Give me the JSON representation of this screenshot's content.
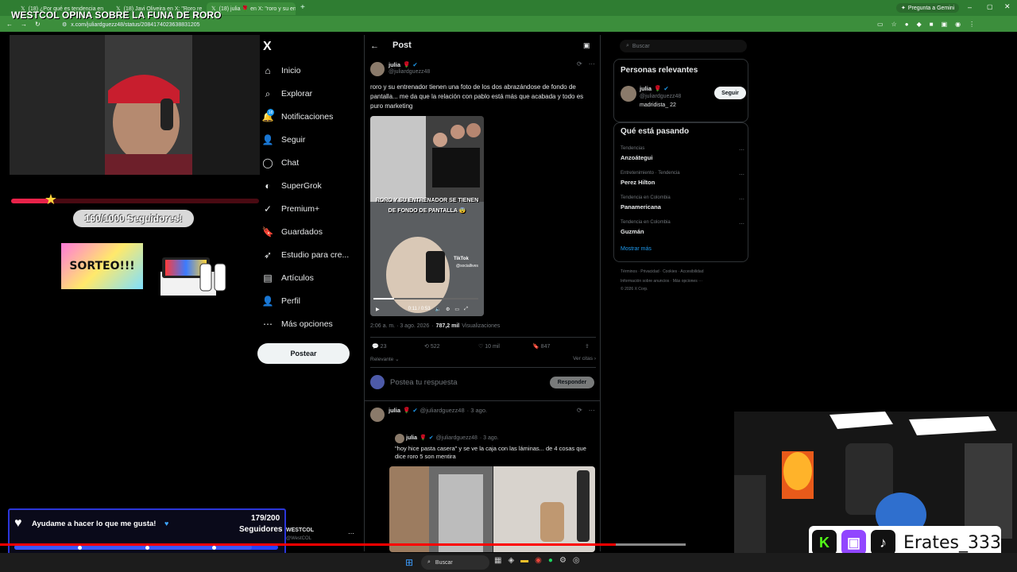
{
  "browser": {
    "tabs": [
      {
        "label": "(18) ¿Por qué es tendencia en"
      },
      {
        "label": "(18) Javi Oliveira en X: \"Roro re"
      },
      {
        "label": "(18) julia 🌹 en X: \"roro y su en"
      }
    ],
    "url": "x.com/juliardguezz48/status/2084174023638831205",
    "gemini_label": "Pregunta a Gemini"
  },
  "stream": {
    "title": "WESTCOL OPINA SOBRE LA FUNA DE RORO",
    "followers_goal": "160/1000 Seguidores!",
    "followers_progress": 0.16,
    "sorteo_label": "SORTEO!!!",
    "goal_text": "Ayudame a hacer lo que me gusta!",
    "goal_count": "179/200",
    "goal_unit": "Seguidores",
    "goal_progress": 0.9,
    "westcol_label": "WESTCOL",
    "westcol_handle": "@WestCOL",
    "social_handle": "Erates_333"
  },
  "x_nav": {
    "logo": "X",
    "items": [
      {
        "label": "Inicio",
        "icon": "home-icon",
        "glyph": "⌂"
      },
      {
        "label": "Explorar",
        "icon": "search-icon",
        "glyph": "⌕"
      },
      {
        "label": "Notificaciones",
        "icon": "bell-icon",
        "glyph": "🔔"
      },
      {
        "label": "Seguir",
        "icon": "follow-icon",
        "glyph": "👤"
      },
      {
        "label": "Chat",
        "icon": "chat-icon",
        "glyph": "◯"
      },
      {
        "label": "SuperGrok",
        "icon": "grok-icon",
        "glyph": "◐"
      },
      {
        "label": "Premium+",
        "icon": "premium-icon",
        "glyph": "✓"
      },
      {
        "label": "Guardados",
        "icon": "bookmark-icon",
        "glyph": "🔖"
      },
      {
        "label": "Estudio para cre...",
        "icon": "studio-icon",
        "glyph": "➶"
      },
      {
        "label": "Artículos",
        "icon": "articles-icon",
        "glyph": "▤"
      },
      {
        "label": "Perfil",
        "icon": "profile-icon",
        "glyph": "👤"
      },
      {
        "label": "Más opciones",
        "icon": "more-icon",
        "glyph": "⋯"
      }
    ],
    "notifications_badge": "18",
    "post_button": "Postear"
  },
  "post": {
    "header": "Post",
    "author": "julia",
    "handle": "@juliardguezz48",
    "text": "roro y su entrenador tienen una foto de los dos abrazándose de fondo de pantalla... me da que la relación con pablo está más que acabada y todo es puro marketing",
    "video_caption": "RORO Y SU ENTRENADOR SE TIENEN DE FONDO DE PANTALLA 😨",
    "video_time": "0:11 / 0:53",
    "tiktok_label": "TikTok",
    "tiktok_user": "@sociallives",
    "timestamp": "2:06 a. m. · 3 ago. 2026",
    "views_count": "787,2 mil",
    "views_label": "Visualizaciones",
    "replies": "23",
    "reposts": "522",
    "likes": "10 mil",
    "bookmarks": "847",
    "sort_label": "Relevante",
    "quotes_label": "Ver citas",
    "reply_placeholder": "Postea tu respuesta",
    "reply_button": "Responder"
  },
  "reply": {
    "author": "julia",
    "handle": "@juliardguezz48",
    "date": "· 3 ago.",
    "quoted_author": "julia",
    "quoted_handle": "@juliardguezz48",
    "quoted_date": "· 3 ago.",
    "quoted_text": "\"hoy hice pasta casera\" y se ve la caja con las láminas... de 4 cosas que dice roro 5 son mentira"
  },
  "sidebar": {
    "search_placeholder": "Buscar",
    "relevant_title": "Personas relevantes",
    "person_name": "julia",
    "person_handle": "@juliardguezz48",
    "person_bio": "madridista_ 22",
    "follow_button": "Seguir",
    "trends_title": "Qué está pasando",
    "trends": [
      {
        "context": "Tendencias",
        "name": "Anzoátegui"
      },
      {
        "context": "Entretenimiento · Tendencia",
        "name": "Perez Hilton"
      },
      {
        "context": "Tendencia en Colombia",
        "name": "Panamericana"
      },
      {
        "context": "Tendencia en Colombia",
        "name": "Guzmán"
      }
    ],
    "show_more": "Mostrar más",
    "footer_line1": "Términos · Privacidad · Cookies · Accesibilidad",
    "footer_line2": "Información sobre anuncios · Más opciones ···",
    "footer_line3": "© 2026 X Corp."
  },
  "taskbar": {
    "search_label": "Buscar"
  },
  "colors": {
    "accent_blue": "#1d9bf0",
    "chrome_green": "#3c8e3c",
    "progress_red": "#e8234a",
    "goal_blue": "#2740ff"
  }
}
